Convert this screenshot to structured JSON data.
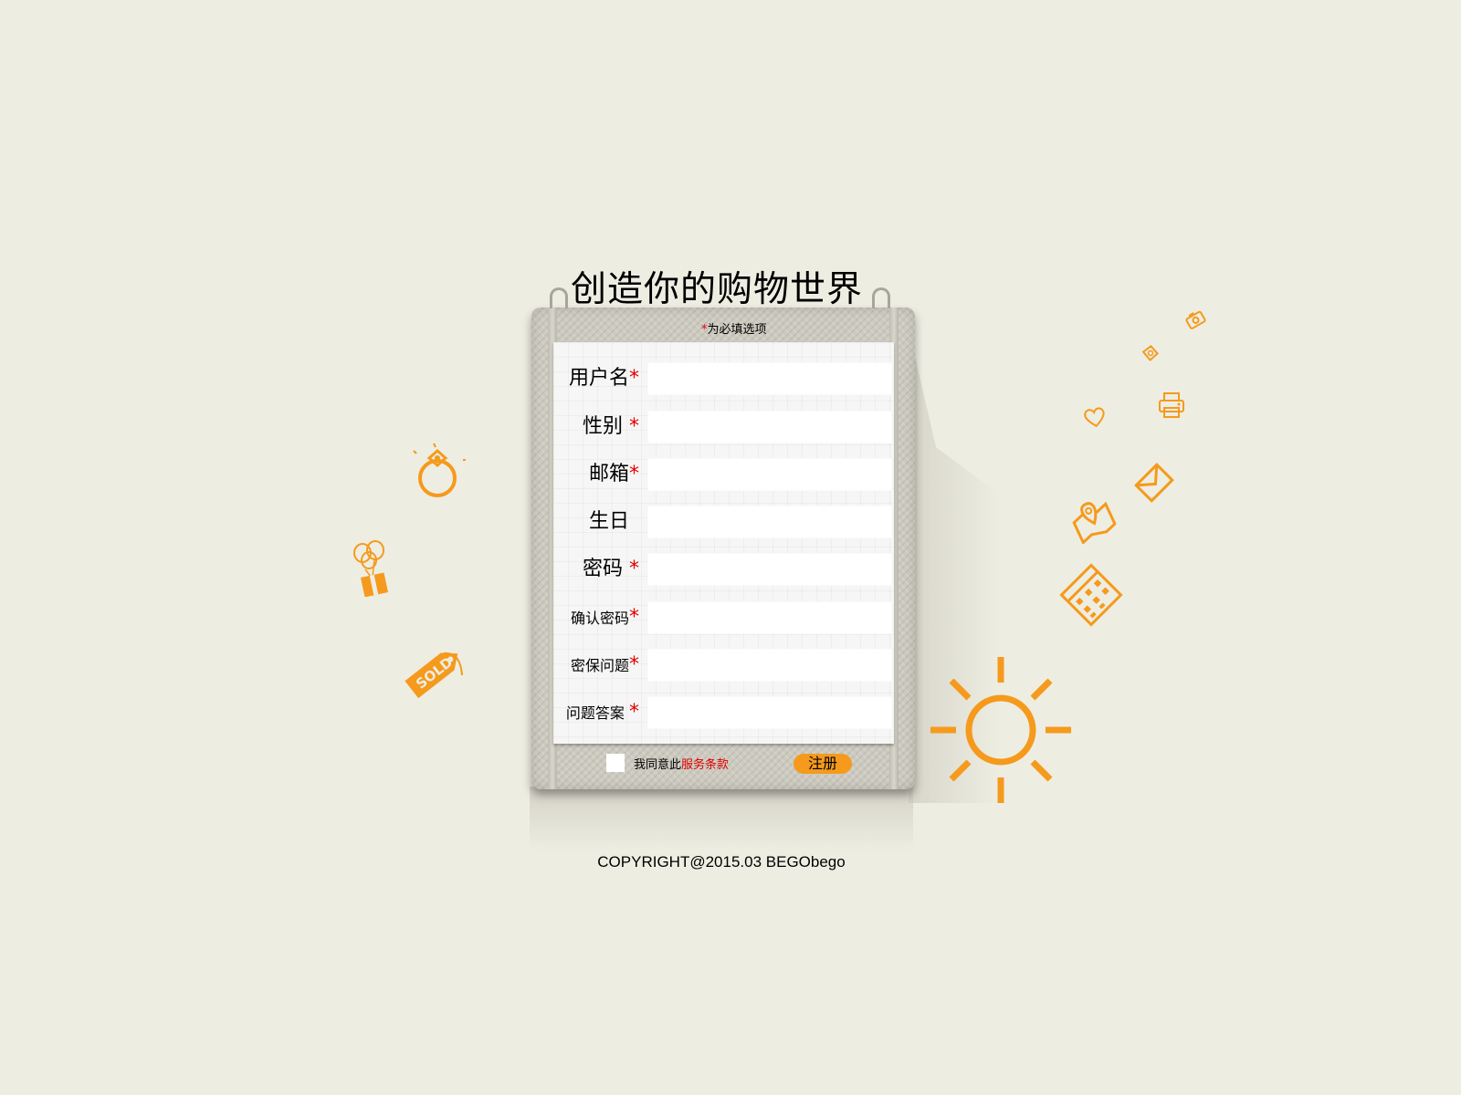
{
  "title": "创造你的购物世界",
  "required_note": {
    "star": "*",
    "text": "为必填选项"
  },
  "fields": [
    {
      "label": "用户名",
      "required": true,
      "value": ""
    },
    {
      "label": "性别",
      "required": true,
      "value": ""
    },
    {
      "label": "邮箱",
      "required": true,
      "value": ""
    },
    {
      "label": "生日",
      "required": false,
      "value": ""
    },
    {
      "label": "密码",
      "required": true,
      "value": ""
    },
    {
      "label": "确认密码",
      "required": true,
      "value": ""
    },
    {
      "label": "密保问题",
      "required": true,
      "value": ""
    },
    {
      "label": "问题答案",
      "required": true,
      "value": ""
    }
  ],
  "star": "*",
  "agreement": {
    "text": "我同意此",
    "link": "服务条款",
    "checked": false
  },
  "register_label": "注册",
  "copyright": "COPYRIGHT@2015.03 BEGObego",
  "colors": {
    "background": "#eeede2",
    "accent_orange": "#f59a1c",
    "required_red": "#e00000"
  },
  "icons": [
    "ring-icon",
    "gift-balloons-icon",
    "sold-tag-icon",
    "camera-icon",
    "lock-tag-icon",
    "heart-icon",
    "printer-icon",
    "envelope-icon",
    "map-pin-icon",
    "calculator-icon",
    "sun-icon"
  ]
}
